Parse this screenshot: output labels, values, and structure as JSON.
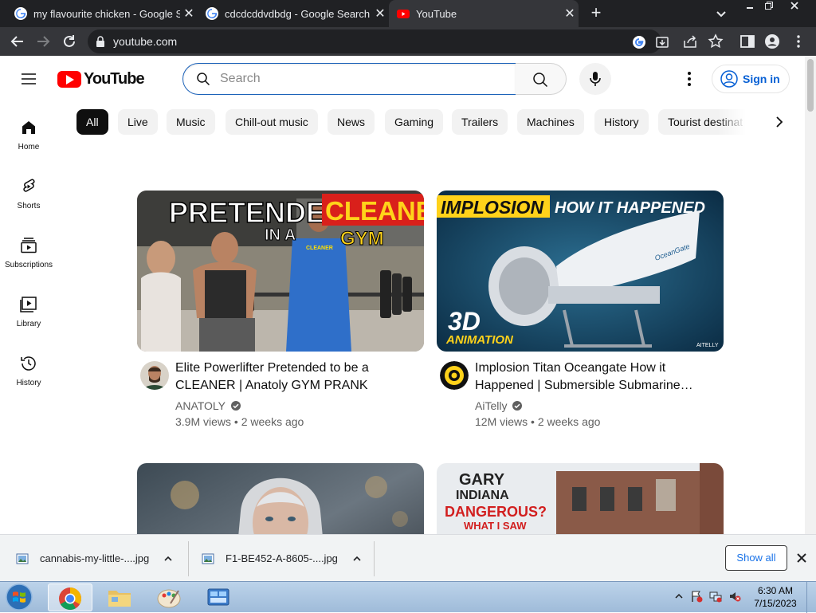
{
  "browser": {
    "tabs": [
      {
        "title": "my flavourite chicken - Google Se",
        "icon": "google-icon"
      },
      {
        "title": "cdcdcddvdbdg - Google Search",
        "icon": "google-icon"
      },
      {
        "title": "YouTube",
        "icon": "youtube-icon",
        "active": true
      }
    ],
    "address": "youtube.com"
  },
  "youtube": {
    "logo_text": "YouTube",
    "search": {
      "placeholder": "Search",
      "value": ""
    },
    "signin_label": "Sign in",
    "chips": [
      "All",
      "Live",
      "Music",
      "Chill-out music",
      "News",
      "Gaming",
      "Trailers",
      "Machines",
      "History",
      "Tourist destinat"
    ],
    "selected_chip": "All",
    "guide": [
      {
        "label": "Home",
        "icon": "home-icon"
      },
      {
        "label": "Shorts",
        "icon": "shorts-icon"
      },
      {
        "label": "Subscriptions",
        "icon": "subscriptions-icon"
      },
      {
        "label": "Library",
        "icon": "library-icon"
      },
      {
        "label": "History",
        "icon": "history-icon"
      }
    ],
    "videos": [
      {
        "title": "Elite Powerlifter Pretended to be a CLEANER | Anatoly GYM PRANK",
        "channel": "ANATOLY",
        "verified": true,
        "views": "3.9M views",
        "age": "2 weeks ago",
        "thumb_text": [
          "PRETENDED",
          "IN A",
          "CLEANER",
          "GYM",
          "CLEANER"
        ]
      },
      {
        "title": "Implosion Titan Oceangate How it Happened | Submersible Submarine…",
        "channel": "AiTelly",
        "verified": true,
        "views": "12M views",
        "age": "2 weeks ago",
        "thumb_text": [
          "IMPLOSION",
          "HOW IT HAPPENED",
          "3D",
          "ANIMATION",
          "OceanGate",
          "AITELLY"
        ]
      },
      {
        "title": "",
        "channel": "",
        "views": "",
        "age": "",
        "thumb_text": []
      },
      {
        "title": "",
        "channel": "",
        "views": "",
        "age": "",
        "thumb_text": [
          "GARY",
          "INDIANA",
          "DANGEROUS?",
          "WHAT I SAW"
        ]
      }
    ]
  },
  "downloads": {
    "items": [
      "cannabis-my-little-....jpg",
      "F1-BE452-A-8605-....jpg"
    ],
    "show_all": "Show all"
  },
  "taskbar": {
    "time": "6:30 AM",
    "date": "7/15/2023"
  },
  "colors": {
    "brand_red": "#ff0000",
    "link_blue": "#065fd4",
    "chrome_dark": "#202124"
  }
}
